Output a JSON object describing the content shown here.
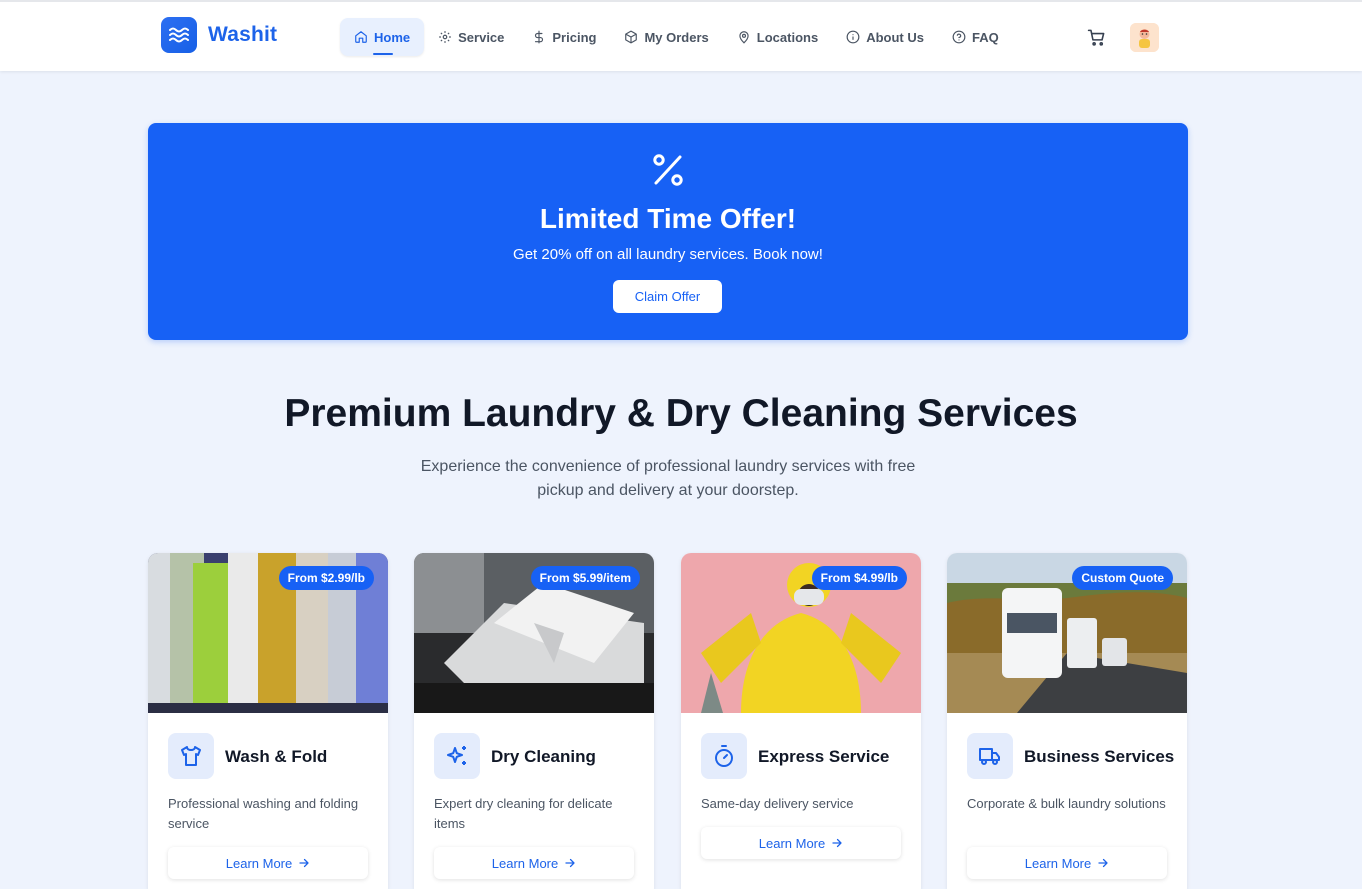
{
  "brand": {
    "name": "Washit"
  },
  "nav": [
    {
      "label": "Home",
      "icon": "home-icon",
      "active": true
    },
    {
      "label": "Service",
      "icon": "gear-icon"
    },
    {
      "label": "Pricing",
      "icon": "dollar-icon"
    },
    {
      "label": "My Orders",
      "icon": "box-icon"
    },
    {
      "label": "Locations",
      "icon": "map-pin-icon"
    },
    {
      "label": "About Us",
      "icon": "info-icon"
    },
    {
      "label": "FAQ",
      "icon": "help-icon"
    }
  ],
  "banner": {
    "title": "Limited Time Offer!",
    "subtitle": "Get 20% off on all laundry services. Book now!",
    "button": "Claim Offer",
    "icon": "percent-icon"
  },
  "hero": {
    "title": "Premium Laundry & Dry Cleaning Services",
    "subtitle": "Experience the convenience of professional laundry services with free pickup and delivery at your doorstep."
  },
  "services": [
    {
      "price": "From $2.99/lb",
      "title": "Wash & Fold",
      "description": "Professional washing and folding service",
      "button": "Learn More",
      "icon": "shirt-icon"
    },
    {
      "price": "From $5.99/item",
      "title": "Dry Cleaning",
      "description": "Expert dry cleaning for delicate items",
      "button": "Learn More",
      "icon": "sparkles-icon"
    },
    {
      "price": "From $4.99/lb",
      "title": "Express Service",
      "description": "Same-day delivery service",
      "button": "Learn More",
      "icon": "timer-icon"
    },
    {
      "price": "Custom Quote",
      "title": "Business Services",
      "description": "Corporate & bulk laundry solutions",
      "button": "Learn More",
      "icon": "truck-icon"
    }
  ],
  "colors": {
    "primary": "#1761f5",
    "background": "#eef3fd",
    "accent_text": "#1d63e9"
  }
}
